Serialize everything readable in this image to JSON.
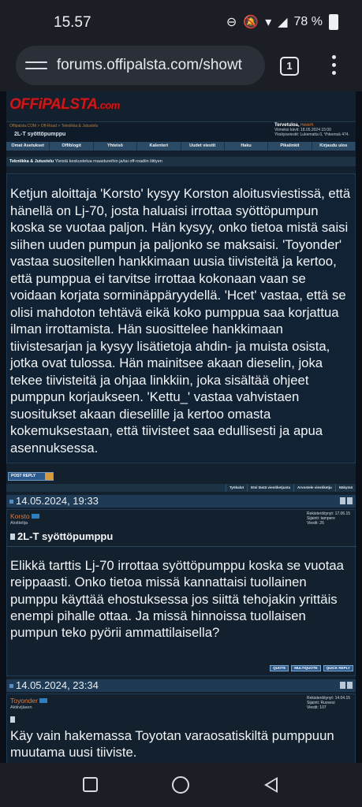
{
  "status": {
    "time": "15.57",
    "battery": "78 %"
  },
  "browser": {
    "url": "forums.offipalsta.com/showt",
    "tab_count": "1"
  },
  "site": {
    "logo_main": "OFFiPALSTA",
    "logo_tld": ".com",
    "breadcrumb": "Offipalsta.COM > Off-Road > Tekniikka & Jutustelu",
    "thread_title": "2L-T syöttöpumppu",
    "welcome": {
      "label": "Tervetuloa,",
      "user": "HekkiH.",
      "last_visit": "Viimeksi kävit: 18.05.2024 15:00",
      "private_messages": "Yksityisviestit: Lukematta 0, Yhteensä 474."
    },
    "nav": [
      "Omat Asetukset",
      "Offiblogit",
      "Yhteisö",
      "Kalenteri",
      "Uudet viestit",
      "Haku",
      "Pikalinkit",
      "Kirjaudu ulos"
    ],
    "forum": {
      "name": "Tekniikka & Jutustelu",
      "desc": "Yleistä keskustelua maasturеihin ja/tai off-roadiin liittyen"
    }
  },
  "summary": "Ketjun aloittaja 'Korsto' kysyy Korston aloitusviestissä, että hänellä on Lj-70, josta haluaisi irrottaa syöttöpumpun koska se vuotaa paljon. Hän kysyy, onko tietoa mistä saisi siihen uuden pumpun ja paljonko se maksaisi. 'Toyonder' vastaa suositellen hankkimaan uusia tiivisteitä ja kertoo, että pumppua ei tarvitse irrottaa kokonaan vaan se voidaan korjata sorminäppäryydellä. 'Hcet' vastaa, että se olisi mahdoton tehtävä eikä koko pumppua saa korjattua ilman irrottamista. Hän suosittelee hankkimaan tiivistesarjan ja kysyy lisätietoja ahdin- ja muista osista, jotka ovat tulossa. Hän mainitsee akaan dieselin, joka tekee tiivisteitä ja ohjaa linkkiin, joka sisältää ohjeet pumppun korjaukseen. 'Kettu_' vastaa vahvistaen suositukset akaan dieselille ja kertoo omasta kokemuksestaan, että tiivisteet saa edullisesti ja apua asennuksessa.",
  "post_reply_label": "POST REPLY",
  "tools": [
    "Työkalut",
    "Etsi tästä viestiketjusta",
    "Arvostele viestiketju",
    "Näkymä"
  ],
  "posts": [
    {
      "date": "14.05.2024, 19:33",
      "user": "Korsto",
      "rank": "Aloittelija",
      "stats": [
        "Rekisteröitynyt: 17.06.15",
        "Sijainti: tampere",
        "Viestit: 26"
      ],
      "title": "2L-T syöttöpumppu",
      "text": "Elikkä tarttis Lj-70 irrottaa syöttöpumppu koska se vuotaa reippaasti. Onko tietoa missä kannattaisi tuollainen pumppu käyttää ehostuksessa jos siittä tehojakin yrittäis enempi pihalle ottaa. Ja missä hinnoissa tuollaisen pumpun teko pyörii ammattilaisella?",
      "buttons": [
        "QUOTE",
        "MULTIQUOTE",
        "QUICK REPLY"
      ]
    },
    {
      "date": "14.05.2024, 23:34",
      "user": "Toyonder",
      "rank": "Aktiivijäsen",
      "stats": [
        "Rekisteröitynyt: 14.04.15",
        "Sijainti: Ruovesi",
        "Viestit: 107"
      ],
      "text": "Käy vain hakemassa Toyotan varaosatiskiltä pumppuun muutama uusi tiiviste."
    }
  ]
}
